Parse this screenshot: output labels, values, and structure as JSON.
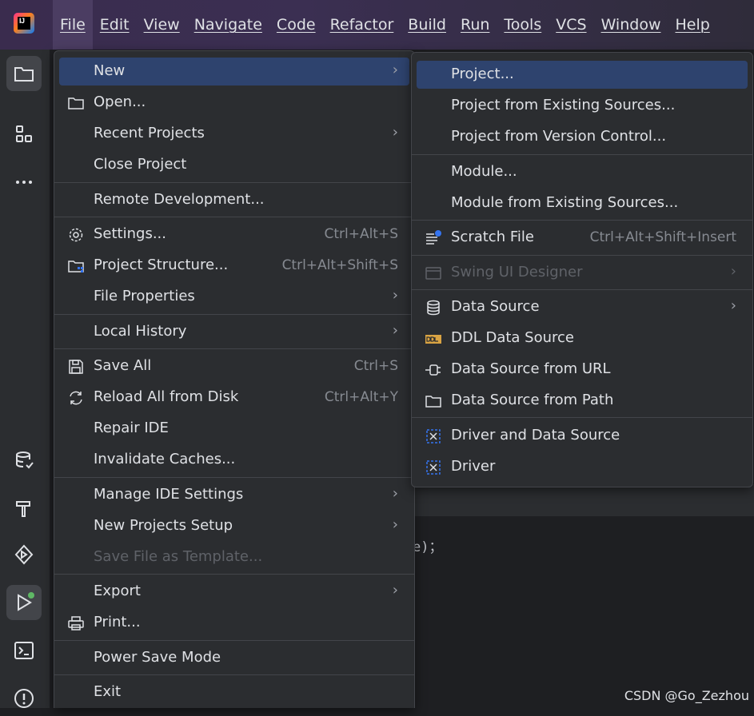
{
  "app": {
    "logo_text": "IJ"
  },
  "menubar": [
    {
      "label": "File"
    },
    {
      "label": "Edit"
    },
    {
      "label": "View"
    },
    {
      "label": "Navigate"
    },
    {
      "label": "Code"
    },
    {
      "label": "Refactor"
    },
    {
      "label": "Build"
    },
    {
      "label": "Run"
    },
    {
      "label": "Tools"
    },
    {
      "label": "VCS"
    },
    {
      "label": "Window"
    },
    {
      "label": "Help"
    }
  ],
  "file_menu": {
    "items": [
      {
        "label": "New",
        "shortcut": "",
        "submenu": true
      },
      {
        "label": "Open...",
        "shortcut": "",
        "icon": "folder-icon"
      },
      {
        "label": "Recent Projects",
        "shortcut": "",
        "submenu": true
      },
      {
        "label": "Close Project",
        "shortcut": ""
      },
      {
        "label": "Remote Development...",
        "shortcut": ""
      },
      {
        "label": "Settings...",
        "shortcut": "Ctrl+Alt+S",
        "icon": "gear-icon"
      },
      {
        "label": "Project Structure...",
        "shortcut": "Ctrl+Alt+Shift+S",
        "icon": "project-structure-icon"
      },
      {
        "label": "File Properties",
        "shortcut": "",
        "submenu": true
      },
      {
        "label": "Local History",
        "shortcut": "",
        "submenu": true
      },
      {
        "label": "Save All",
        "shortcut": "Ctrl+S",
        "icon": "save-icon"
      },
      {
        "label": "Reload All from Disk",
        "shortcut": "Ctrl+Alt+Y",
        "icon": "reload-icon"
      },
      {
        "label": "Repair IDE",
        "shortcut": ""
      },
      {
        "label": "Invalidate Caches...",
        "shortcut": ""
      },
      {
        "label": "Manage IDE Settings",
        "shortcut": "",
        "submenu": true
      },
      {
        "label": "New Projects Setup",
        "shortcut": "",
        "submenu": true
      },
      {
        "label": "Save File as Template...",
        "shortcut": "",
        "disabled": true
      },
      {
        "label": "Export",
        "shortcut": "",
        "submenu": true
      },
      {
        "label": "Print...",
        "shortcut": "",
        "icon": "print-icon"
      },
      {
        "label": "Power Save Mode",
        "shortcut": ""
      },
      {
        "label": "Exit",
        "shortcut": ""
      }
    ]
  },
  "new_submenu": {
    "items": [
      {
        "label": "Project...",
        "shortcut": ""
      },
      {
        "label": "Project from Existing Sources...",
        "shortcut": ""
      },
      {
        "label": "Project from Version Control...",
        "shortcut": ""
      },
      {
        "label": "Module...",
        "shortcut": ""
      },
      {
        "label": "Module from Existing Sources...",
        "shortcut": ""
      },
      {
        "label": "Scratch File",
        "shortcut": "Ctrl+Alt+Shift+Insert",
        "icon": "scratch-file-icon"
      },
      {
        "label": "Swing UI Designer",
        "shortcut": "",
        "submenu": true,
        "disabled": true,
        "icon": "swing-designer-icon"
      },
      {
        "label": "Data Source",
        "shortcut": "",
        "submenu": true,
        "icon": "database-icon"
      },
      {
        "label": "DDL Data Source",
        "shortcut": "",
        "icon": "ddl-icon"
      },
      {
        "label": "Data Source from URL",
        "shortcut": "",
        "icon": "plug-icon"
      },
      {
        "label": "Data Source from Path",
        "shortcut": "",
        "icon": "folder-icon"
      },
      {
        "label": "Driver and Data Source",
        "shortcut": "",
        "icon": "driver-icon"
      },
      {
        "label": "Driver",
        "shortcut": "",
        "icon": "driver-icon"
      }
    ]
  },
  "arrow_glyph": "›",
  "editor": {
    "fragment": "e)；"
  },
  "watermark": "CSDN @Go_Zezhou",
  "colors": {
    "highlight": "#2e436e",
    "menu_bg": "#2b2d30",
    "titlebar": "#3b2f52"
  }
}
